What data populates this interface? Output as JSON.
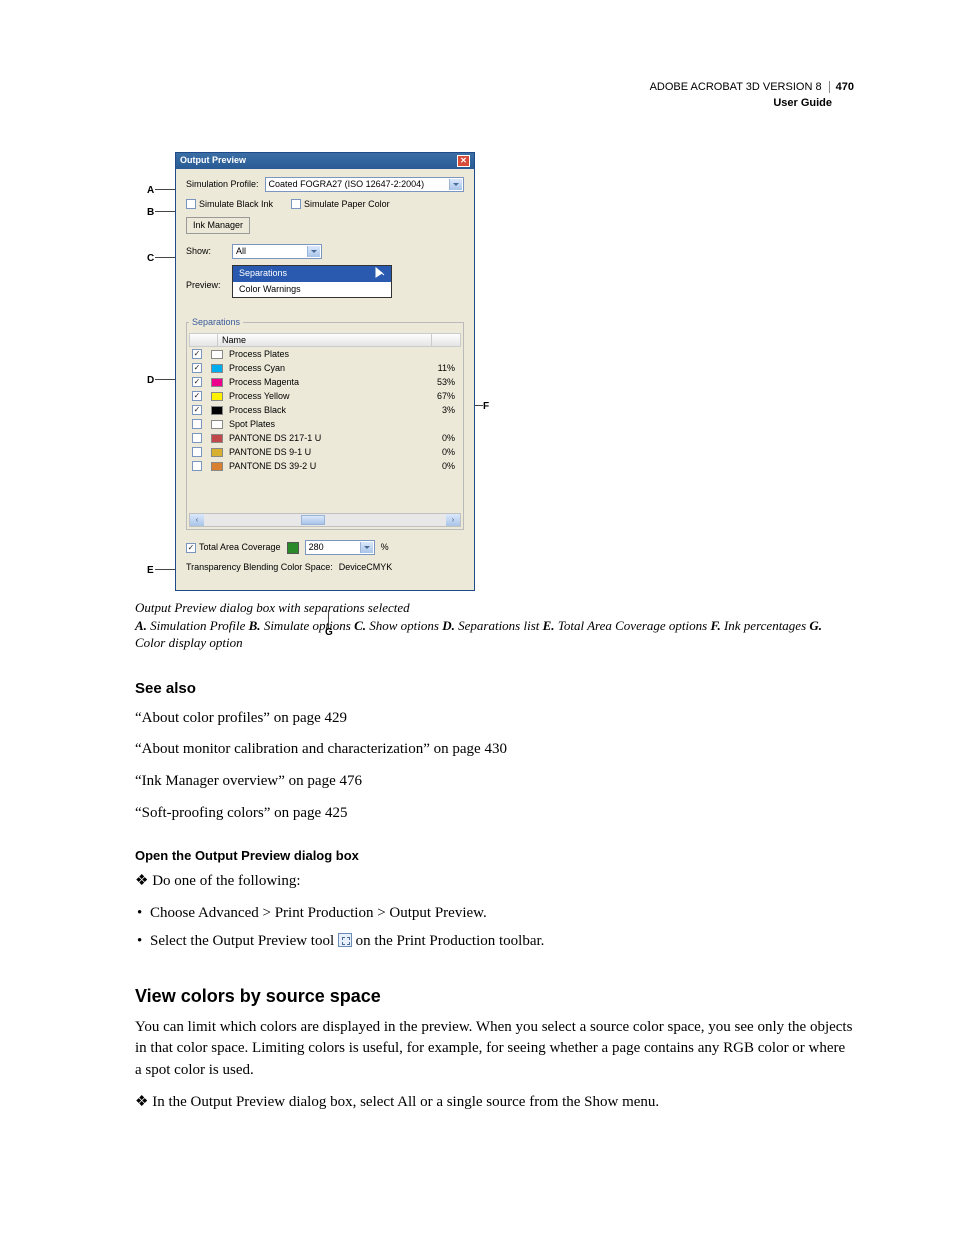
{
  "header": {
    "product": "ADOBE ACROBAT 3D VERSION 8",
    "page_num": "470",
    "guide": "User Guide"
  },
  "dlg": {
    "title": "Output Preview",
    "sim_label": "Simulation Profile:",
    "sim_value": "Coated FOGRA27 (ISO 12647-2:2004)",
    "sim_black": "Simulate Black Ink",
    "sim_paper": "Simulate Paper Color",
    "ink_mgr": "Ink Manager",
    "show_label": "Show:",
    "show_value": "All",
    "preview_label": "Preview:",
    "menu_sel": "Separations",
    "menu_other": "Color Warnings",
    "sep_legend": "Separations",
    "name_hdr": "Name",
    "rows": [
      {
        "checked": true,
        "name": "Process Plates",
        "pct": "",
        "color": "#ffffff"
      },
      {
        "checked": true,
        "name": "Process Cyan",
        "pct": "11%",
        "color": "#00aeef"
      },
      {
        "checked": true,
        "name": "Process Magenta",
        "pct": "53%",
        "color": "#ec008c"
      },
      {
        "checked": true,
        "name": "Process Yellow",
        "pct": "67%",
        "color": "#fff200"
      },
      {
        "checked": true,
        "name": "Process Black",
        "pct": "3%",
        "color": "#000000"
      },
      {
        "checked": false,
        "name": "Spot Plates",
        "pct": "",
        "color": "#ffffff"
      },
      {
        "checked": false,
        "name": "PANTONE DS 217-1 U",
        "pct": "0%",
        "color": "#c04848"
      },
      {
        "checked": false,
        "name": "PANTONE DS 9-1 U",
        "pct": "0%",
        "color": "#d8b030"
      },
      {
        "checked": false,
        "name": "PANTONE DS 39-2 U",
        "pct": "0%",
        "color": "#d88030"
      }
    ],
    "tac_label": "Total Area Coverage",
    "tac_value": "280",
    "tac_pct": "%",
    "tbcs_label": "Transparency Blending Color Space:",
    "tbcs_value": "DeviceCMYK"
  },
  "callouts": {
    "A": "A",
    "B": "B",
    "C": "C",
    "D": "D",
    "E": "E",
    "F": "F",
    "G": "G"
  },
  "figcap": {
    "line1": "Output Preview dialog box with separations selected",
    "defs": [
      [
        "A.",
        "Simulation Profile"
      ],
      [
        "B.",
        "Simulate options"
      ],
      [
        "C.",
        "Show options"
      ],
      [
        "D.",
        "Separations list"
      ],
      [
        "E.",
        "Total Area Coverage options"
      ],
      [
        "F.",
        "Ink percentages"
      ],
      [
        "G.",
        "Color display option"
      ]
    ]
  },
  "seealso": {
    "heading": "See also",
    "links": [
      "“About color profiles” on page 429",
      "“About monitor calibration and characterization” on page 430",
      "“Ink Manager overview” on page 476",
      "“Soft-proofing colors” on page 425"
    ]
  },
  "openbox": {
    "heading": "Open the Output Preview dialog box",
    "lead": "Do one of the following:",
    "items_a": "Choose Advanced > Print Production > Output Preview.",
    "items_b_pre": "Select the Output Preview tool ",
    "items_b_post": " on the Print Production toolbar."
  },
  "view": {
    "heading": "View colors by source space",
    "para": "You can limit which colors are displayed in the preview. When you select a source color space, you see only the objects in that color space. Limiting colors is useful, for example, for seeing whether a page contains any RGB color or where a spot color is used.",
    "step": "In the Output Preview dialog box, select All or a single source from the Show menu."
  }
}
